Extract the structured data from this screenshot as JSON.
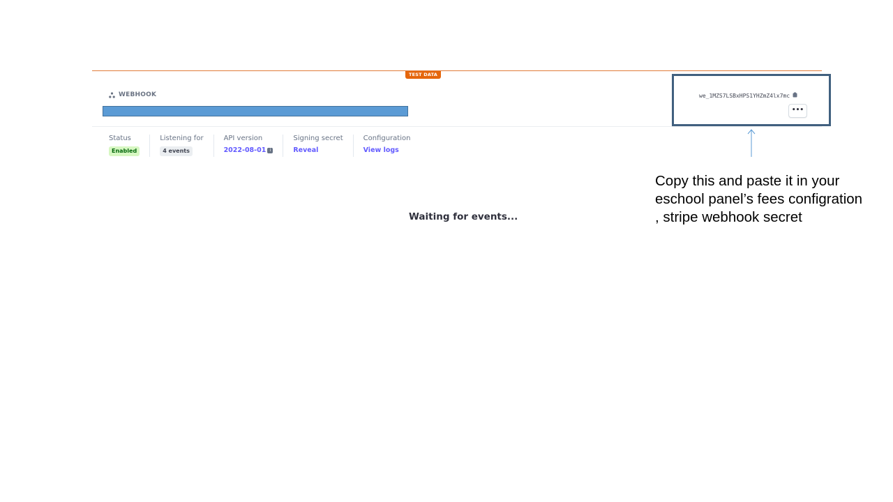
{
  "test_badge": "TEST DATA",
  "header": {
    "label": "WEBHOOK",
    "icon": "webhook-icon"
  },
  "meta": {
    "status_label": "Status",
    "status_value": "Enabled",
    "listening_label": "Listening for",
    "listening_value": "4 events",
    "api_label": "API version",
    "api_value": "2022-08-01",
    "signing_label": "Signing secret",
    "signing_value": "Reveal",
    "config_label": "Configuration",
    "config_value": "View logs"
  },
  "webhook_id": "we_1MZS7LSBxHPS1YHZmZ4lx7mc",
  "more_label": "•••",
  "waiting": "Waiting for events...",
  "annotation": "Copy this and paste it in your eschool panel’s fees configration , stripe webhook secret",
  "colors": {
    "accent": "#635bff",
    "test_orange": "#e5660c",
    "highlight": "#41607f",
    "redaction": "#5b9bd5"
  }
}
